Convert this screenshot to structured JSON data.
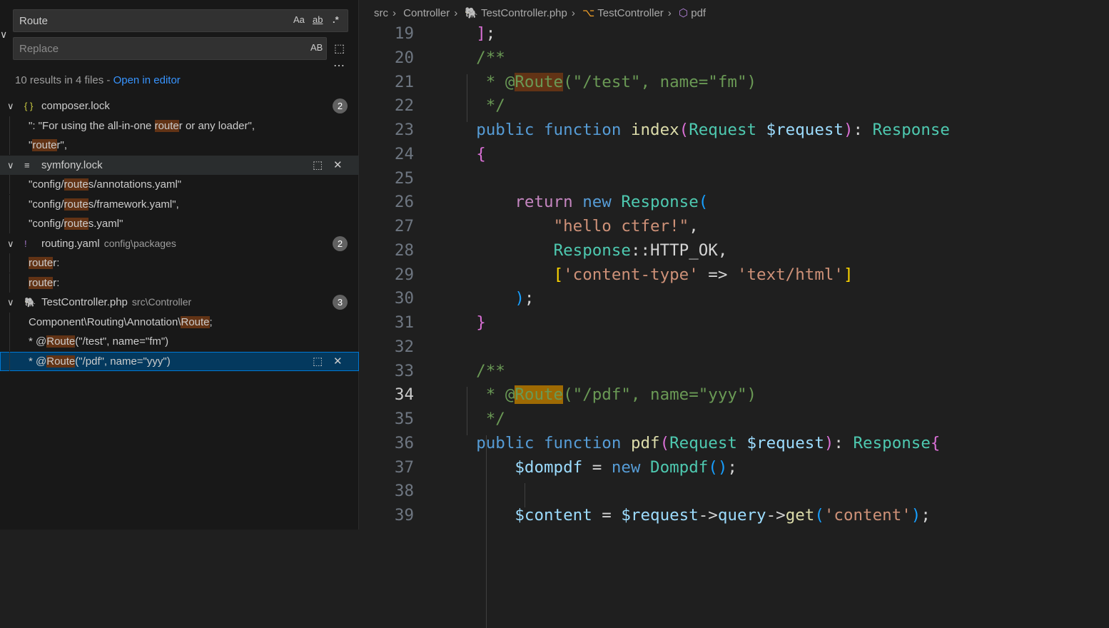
{
  "search": {
    "query": "Route",
    "replace_placeholder": "Replace",
    "opt_case": "Aa",
    "opt_word": "ab",
    "opt_regex": ".*",
    "opt_preserve": "AB",
    "summary": "10 results in 4 files - ",
    "open_in_editor": "Open in editor"
  },
  "results": [
    {
      "file": "composer.lock",
      "path": "",
      "icon": "json-icon",
      "icon_glyph": "{ }",
      "icon_color": "#cbcb41",
      "count": "2",
      "matches": [
        {
          "pre": "\": \"For using the all-in-one ",
          "hit": "route",
          "post": "r or any loader\","
        },
        {
          "pre": "\"",
          "hit": "route",
          "post": "r\","
        }
      ]
    },
    {
      "file": "symfony.lock",
      "path": "",
      "icon": "text-file-icon",
      "icon_glyph": "≡",
      "icon_color": "#cccccc",
      "count": "",
      "matches": [
        {
          "pre": "\"config/",
          "hit": "route",
          "post": "s/annotations.yaml\""
        },
        {
          "pre": "\"config/",
          "hit": "route",
          "post": "s/framework.yaml\","
        },
        {
          "pre": "\"config/",
          "hit": "route",
          "post": "s.yaml\""
        }
      ]
    },
    {
      "file": "routing.yaml",
      "path": "config\\packages",
      "icon": "yaml-icon",
      "icon_glyph": "!",
      "icon_color": "#a074c4",
      "count": "2",
      "matches": [
        {
          "pre": "",
          "hit": "route",
          "post": "r:"
        },
        {
          "pre": "",
          "hit": "route",
          "post": "r:"
        }
      ]
    },
    {
      "file": "TestController.php",
      "path": "src\\Controller",
      "icon": "php-elephant-icon",
      "icon_glyph": "🐘",
      "icon_color": "#a074c4",
      "count": "3",
      "matches": [
        {
          "pre": "Component\\Routing\\Annotation\\",
          "hit": "Route",
          "post": ";"
        },
        {
          "pre": "* @",
          "hit": "Route",
          "post": "(\"/test\", name=\"fm\")"
        },
        {
          "pre": "* @",
          "hit": "Route",
          "post": "(\"/pdf\", name=\"yyy\")"
        }
      ]
    }
  ],
  "breadcrumb": [
    "src",
    "Controller",
    "TestController.php",
    "TestController",
    "pdf"
  ],
  "editor": {
    "current_line": 34,
    "lines": [
      {
        "n": "19",
        "t": [
          [
            "    ",
            "p"
          ],
          [
            "]",
            "b2"
          ],
          [
            ";",
            "p"
          ]
        ]
      },
      {
        "n": "20",
        "t": [
          [
            "    /**",
            "m"
          ]
        ]
      },
      {
        "n": "21",
        "t": [
          [
            "     * @",
            "m"
          ],
          [
            "Route",
            "h"
          ],
          [
            "(\"/test\", name=\"fm\")",
            "m"
          ]
        ]
      },
      {
        "n": "22",
        "t": [
          [
            "     */",
            "m"
          ]
        ]
      },
      {
        "n": "23",
        "t": [
          [
            "    ",
            "p"
          ],
          [
            "public",
            "k"
          ],
          [
            " ",
            "p"
          ],
          [
            "function",
            "k"
          ],
          [
            " ",
            "p"
          ],
          [
            "index",
            "f"
          ],
          [
            "(",
            "b2"
          ],
          [
            "Request",
            "t"
          ],
          [
            " ",
            "p"
          ],
          [
            "$request",
            "v"
          ],
          [
            ")",
            "b2"
          ],
          [
            ": ",
            "p"
          ],
          [
            "Response",
            "t"
          ]
        ]
      },
      {
        "n": "24",
        "t": [
          [
            "    ",
            "p"
          ],
          [
            "{",
            "b2"
          ]
        ]
      },
      {
        "n": "25",
        "t": []
      },
      {
        "n": "26",
        "t": [
          [
            "        ",
            "p"
          ],
          [
            "return",
            "c"
          ],
          [
            " ",
            "p"
          ],
          [
            "new",
            "k"
          ],
          [
            " ",
            "p"
          ],
          [
            "Response",
            "t"
          ],
          [
            "(",
            "b3"
          ]
        ]
      },
      {
        "n": "27",
        "t": [
          [
            "            ",
            "p"
          ],
          [
            "\"hello ctfer!\"",
            "s"
          ],
          [
            ",",
            "p"
          ]
        ]
      },
      {
        "n": "28",
        "t": [
          [
            "            ",
            "p"
          ],
          [
            "Response",
            "t"
          ],
          [
            "::HTTP_OK,",
            "p"
          ]
        ]
      },
      {
        "n": "29",
        "t": [
          [
            "            ",
            "p"
          ],
          [
            "[",
            "b1"
          ],
          [
            "'content-type'",
            "s"
          ],
          [
            " => ",
            "p"
          ],
          [
            "'text/html'",
            "s"
          ],
          [
            "]",
            "b1"
          ]
        ]
      },
      {
        "n": "30",
        "t": [
          [
            "        ",
            "p"
          ],
          [
            ")",
            "b3"
          ],
          [
            ";",
            "p"
          ]
        ]
      },
      {
        "n": "31",
        "t": [
          [
            "    ",
            "p"
          ],
          [
            "}",
            "b2"
          ]
        ]
      },
      {
        "n": "32",
        "t": []
      },
      {
        "n": "33",
        "t": [
          [
            "    /**",
            "m"
          ]
        ]
      },
      {
        "n": "34",
        "t": [
          [
            "     * @",
            "m"
          ],
          [
            "Route",
            "hc"
          ],
          [
            "(\"/pdf\", name=\"yyy\")",
            "m"
          ]
        ]
      },
      {
        "n": "35",
        "t": [
          [
            "     */",
            "m"
          ]
        ]
      },
      {
        "n": "36",
        "t": [
          [
            "    ",
            "p"
          ],
          [
            "public",
            "k"
          ],
          [
            " ",
            "p"
          ],
          [
            "function",
            "k"
          ],
          [
            " ",
            "p"
          ],
          [
            "pdf",
            "f"
          ],
          [
            "(",
            "b2"
          ],
          [
            "Request",
            "t"
          ],
          [
            " ",
            "p"
          ],
          [
            "$request",
            "v"
          ],
          [
            ")",
            "b2"
          ],
          [
            ": ",
            "p"
          ],
          [
            "Response",
            "t"
          ],
          [
            "{",
            "b2"
          ]
        ]
      },
      {
        "n": "37",
        "t": [
          [
            "        ",
            "p"
          ],
          [
            "$dompdf",
            "v"
          ],
          [
            " = ",
            "p"
          ],
          [
            "new",
            "k"
          ],
          [
            " ",
            "p"
          ],
          [
            "Dompdf",
            "t"
          ],
          [
            "()",
            "b3"
          ],
          [
            ";",
            "p"
          ]
        ]
      },
      {
        "n": "38",
        "t": []
      },
      {
        "n": "39",
        "t": [
          [
            "        ",
            "p"
          ],
          [
            "$content",
            "v"
          ],
          [
            " = ",
            "p"
          ],
          [
            "$request",
            "v"
          ],
          [
            "->",
            "p"
          ],
          [
            "query",
            "v"
          ],
          [
            "->",
            "p"
          ],
          [
            "get",
            "f"
          ],
          [
            "(",
            "b3"
          ],
          [
            "'content'",
            "s"
          ],
          [
            ")",
            "b3"
          ],
          [
            ";",
            "p"
          ]
        ]
      }
    ]
  }
}
